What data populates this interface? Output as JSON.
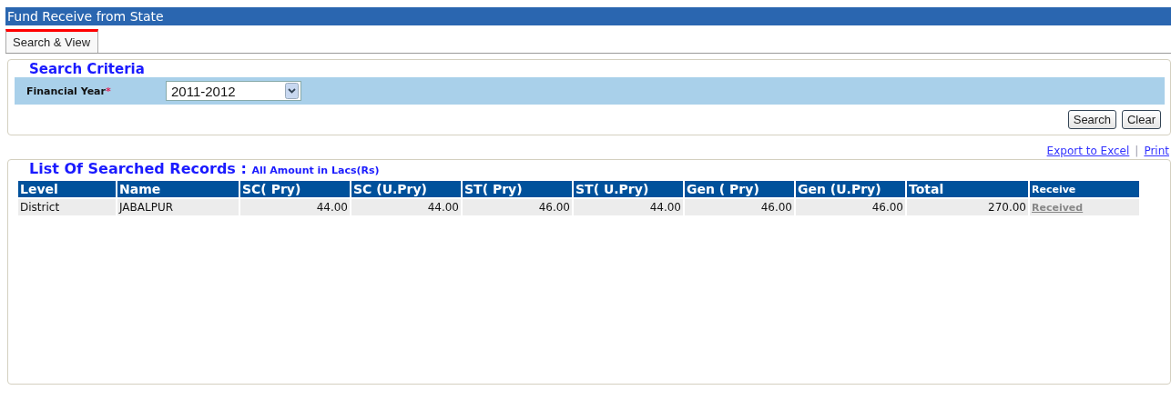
{
  "window": {
    "title": "Fund Receive from State"
  },
  "tabs": [
    {
      "label": "Search & View",
      "selected": true
    }
  ],
  "search_criteria": {
    "legend": "Search Criteria",
    "fields": [
      {
        "label": "Financial Year",
        "required_mark": "*",
        "value": "2011-2012"
      }
    ],
    "buttons": [
      "Search",
      "Clear"
    ]
  },
  "links": {
    "items": [
      "Export to Excel",
      "Print"
    ],
    "separator": "|"
  },
  "records": {
    "legend": "List Of Searched Records :",
    "note": "All Amount in Lacs(Rs)",
    "columns": [
      "Level",
      "Name",
      "SC( Pry)",
      "SC (U.Pry)",
      "ST( Pry)",
      "ST( U.Pry)",
      "Gen ( Pry)",
      "Gen (U.Pry)",
      "Total",
      "Receive"
    ],
    "rows": [
      {
        "cells": [
          "District",
          "JABALPUR",
          "44.00",
          "44.00",
          "46.00",
          "44.00",
          "46.00",
          "46.00",
          "270.00"
        ],
        "receive": "Received"
      }
    ]
  }
}
